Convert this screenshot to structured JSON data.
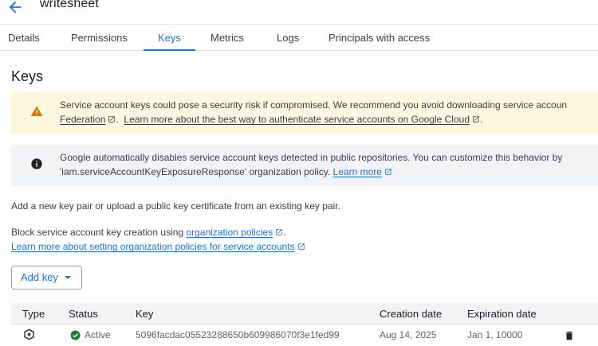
{
  "header": {
    "title": "writesheet",
    "back_icon": "arrow-left-icon"
  },
  "tabs": [
    {
      "label": "Details",
      "active": false
    },
    {
      "label": "Permissions",
      "active": false
    },
    {
      "label": "Keys",
      "active": true
    },
    {
      "label": "Metrics",
      "active": false
    },
    {
      "label": "Logs",
      "active": false
    },
    {
      "label": "Principals with access",
      "active": false
    }
  ],
  "page": {
    "title": "Keys"
  },
  "warning_banner": {
    "icon": "warning-icon",
    "line1": "Service account keys could pose a security risk if compromised. We recommend you avoid downloading service accoun",
    "link1": "Federation",
    "link2": "Learn more about the best way to authenticate service accounts on Google Cloud",
    "end": "."
  },
  "info_banner": {
    "icon": "info-icon",
    "line1": "Google automatically disables service account keys detected in public repositories. You can customize this behavior by",
    "line2": "'iam.serviceAccountKeyExposureResponse' organization policy.",
    "link": "Learn more"
  },
  "description": "Add a new key pair or upload a public key certificate from an existing key pair.",
  "policy": {
    "prefix": "Block service account key creation using",
    "link": "organization policies",
    "suffix": ".",
    "learn_more": "Learn more about setting organization policies for service accounts"
  },
  "add_key_button": {
    "label": "Add key",
    "icon": "dropdown-caret-icon"
  },
  "table": {
    "columns": [
      "Type",
      "Status",
      "Key",
      "Creation date",
      "Expiration date"
    ],
    "rows": [
      {
        "type_icon": "key-type-icon",
        "status": "Active",
        "status_icon": "check-circle-icon",
        "status_color": "#188038",
        "key": "5096facdac05523288650b609986070f3e1fed99",
        "creation_date": "Aug 14, 2025",
        "expiration_date": "Jan 1, 10000",
        "action_icon": "delete-icon"
      }
    ]
  },
  "colors": {
    "accent": "#1a73e8",
    "warning_bg": "#fef7e0",
    "warning_icon": "#e37400",
    "info_bg": "#f1f3f4",
    "success": "#188038"
  }
}
